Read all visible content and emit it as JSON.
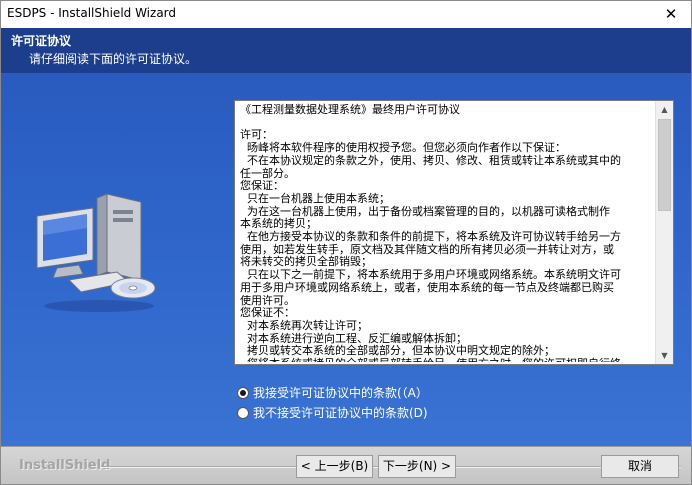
{
  "window": {
    "title": "ESDPS - InstallShield Wizard",
    "close_glyph": "✕"
  },
  "header": {
    "title": "许可证协议",
    "subtitle": "请仔细阅读下面的许可证协议。"
  },
  "license": {
    "lines": [
      "《工程测量数据处理系统》最终用户许可协议",
      "",
      "许可：",
      "  旸峰将本软件程序的使用权授予您。但您必须向作者作以下保证：",
      "  不在本协议规定的条款之外，使用、拷贝、修改、租赁或转让本系统或其中的",
      "任一部分。",
      "您保证：",
      "  只在一台机器上使用本系统；",
      "  为在这一台机器上使用，出于备份或档案管理的目的，以机器可读格式制作",
      "本系统的拷贝；",
      "  在他方接受本协议的条款和条件的前提下，将本系统及许可协议转手给另一方",
      "使用，如若发生转手，原文档及其伴随文档的所有拷贝必须一并转让对方，或",
      "将未转交的拷贝全部销毁；",
      "  只在以下之一前提下，将本系统用于多用户环境或网络系统。本系统明文许可",
      "用于多用户环境或网络系统上，或者，使用本系统的每一节点及终端都已购买",
      "使用许可。",
      "您保证不：",
      "  对本系统再次转让许可；",
      "  对本系统进行逆向工程、反汇编或解体拆卸；",
      "  拷贝或转交本系统的全部或部分，但本协议中明文规定的除外；",
      "  您将本系统或拷贝的全部或局部转手给另一使用方之时，您的许可权即自行终"
    ]
  },
  "options": {
    "accept": "我接受许可证协议中的条款(（A）",
    "decline": "我不接受许可证协议中的条款(D)",
    "selected": "accept"
  },
  "footer": {
    "brand": "InstallShield",
    "back_label": "< 上一步(B)",
    "next_label": "下一步(N) >",
    "cancel_label": "取消"
  },
  "icons": {
    "computer": "computer-with-cd-icon",
    "scroll_up": "scroll-up-arrow-icon",
    "scroll_down": "scroll-down-arrow-icon"
  },
  "colors": {
    "header_bg": "#1c3e8c",
    "body_bg": "#2e64c8",
    "footer_bg": "#c8c8c8"
  }
}
